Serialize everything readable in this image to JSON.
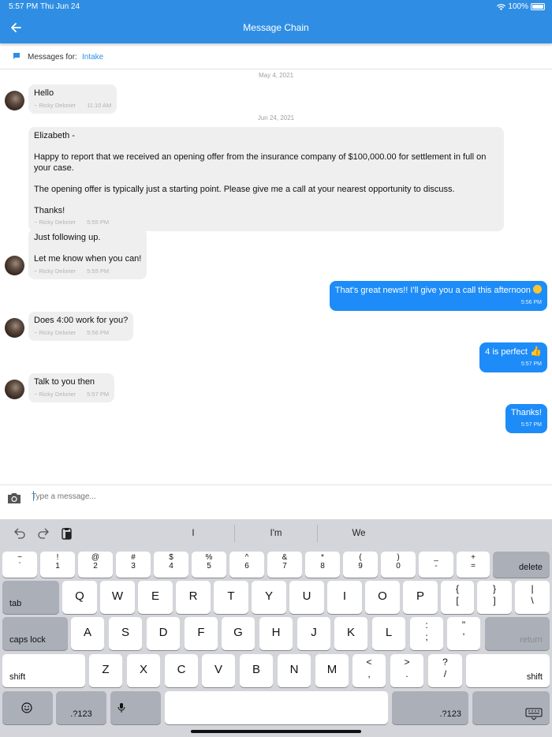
{
  "status": {
    "time": "5:57 PM",
    "date": "Thu Jun 24",
    "battery": "100%"
  },
  "nav": {
    "title": "Message Chain",
    "back_icon": "arrow-left-icon"
  },
  "context": {
    "label": "Messages for:",
    "value": "Intake"
  },
  "dates": [
    "May 4, 2021",
    "Jun 24, 2021"
  ],
  "messages": [
    {
      "dir": "in",
      "text": "Hello",
      "author": "~ Ricky Delorier",
      "time": "11:10 AM"
    },
    {
      "dir": "in",
      "text": "Elizabeth -\n\nHappy to report that we received an opening offer from the insurance company of $100,000.00 for settlement in full on your case.\n\nThe opening offer is typically just a starting point. Please give me a call at your nearest opportunity to discuss.\n\nThanks!",
      "author": "~ Ricky Delorier",
      "time": "5:55 PM"
    },
    {
      "dir": "in",
      "text": "Just following up.\n\nLet me know when you can!",
      "author": "~ Ricky Delorier",
      "time": "5:55 PM"
    },
    {
      "dir": "out",
      "text": "That's great news!! I'll give you a call this afternoon",
      "time": "5:56 PM"
    },
    {
      "dir": "in",
      "text": "Does 4:00 work for you?",
      "author": "~ Ricky Delorier",
      "time": "5:56 PM"
    },
    {
      "dir": "out",
      "text": "4 is perfect",
      "time": "5:57 PM"
    },
    {
      "dir": "in",
      "text": "Talk to you then",
      "author": "~ Ricky Delorier",
      "time": "5:57 PM"
    },
    {
      "dir": "out",
      "text": "Thanks!",
      "time": "5:57 PM"
    }
  ],
  "composer": {
    "placeholder": "Type a message..."
  },
  "keyboard": {
    "suggestions": [
      "I",
      "I'm",
      "We"
    ],
    "row1": [
      {
        "top": "~",
        "bot": "`"
      },
      {
        "top": "!",
        "bot": "1"
      },
      {
        "top": "@",
        "bot": "2"
      },
      {
        "top": "#",
        "bot": "3"
      },
      {
        "top": "$",
        "bot": "4"
      },
      {
        "top": "%",
        "bot": "5"
      },
      {
        "top": "^",
        "bot": "6"
      },
      {
        "top": "&",
        "bot": "7"
      },
      {
        "top": "*",
        "bot": "8"
      },
      {
        "top": "(",
        "bot": "9"
      },
      {
        "top": ")",
        "bot": "0"
      },
      {
        "top": "_",
        "bot": "-"
      },
      {
        "top": "+",
        "bot": "="
      }
    ],
    "delete": "delete",
    "tab": "tab",
    "row2": [
      "Q",
      "W",
      "E",
      "R",
      "T",
      "Y",
      "U",
      "I",
      "O",
      "P"
    ],
    "row2_sym": [
      {
        "top": "{",
        "bot": "["
      },
      {
        "top": "}",
        "bot": "]"
      },
      {
        "top": "|",
        "bot": "\\"
      }
    ],
    "caps": "caps lock",
    "row3": [
      "A",
      "S",
      "D",
      "F",
      "G",
      "H",
      "J",
      "K",
      "L"
    ],
    "row3_sym": [
      {
        "top": ":",
        "bot": ";"
      },
      {
        "top": "\"",
        "bot": "'"
      }
    ],
    "return": "return",
    "shift": "shift",
    "row4": [
      "Z",
      "X",
      "C",
      "V",
      "B",
      "N",
      "M"
    ],
    "row4_sym": [
      {
        "top": "<",
        "bot": ","
      },
      {
        "top": ">",
        "bot": "."
      },
      {
        "top": "?",
        "bot": "/"
      }
    ],
    "num": ".?123"
  }
}
